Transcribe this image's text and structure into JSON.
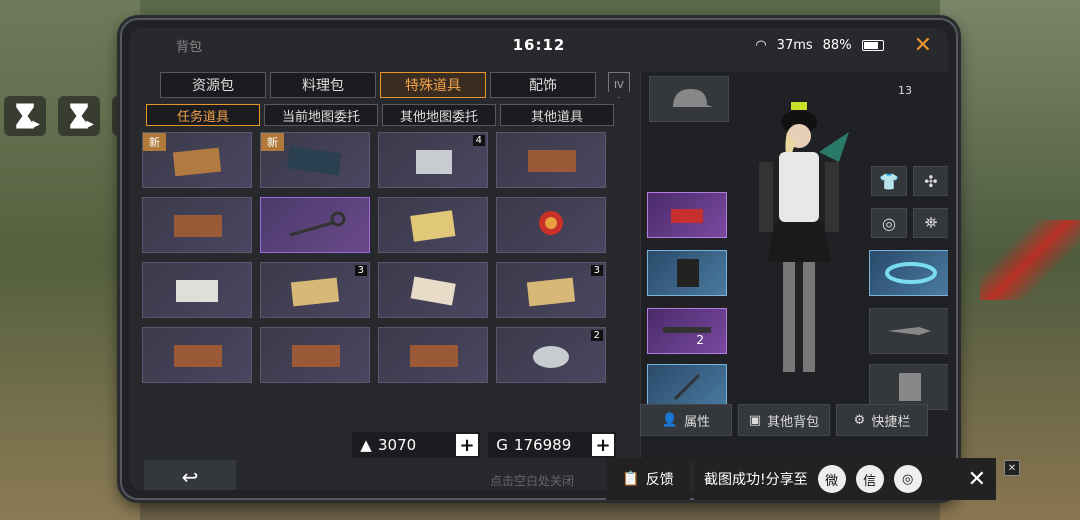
{
  "status": {
    "title": "背包",
    "time": "16:12",
    "ping": "37ms",
    "battery": "88%"
  },
  "tabs": [
    "资源包",
    "料理包",
    "特殊道具",
    "配饰"
  ],
  "tier": "IV",
  "subtabs": [
    "任务道具",
    "当前地图委托",
    "其他地图委托",
    "其他道具"
  ],
  "items": [
    {
      "tag": "新",
      "count": ""
    },
    {
      "tag": "新",
      "count": ""
    },
    {
      "tag": "",
      "count": "4"
    },
    {
      "tag": "",
      "count": ""
    },
    {
      "tag": "",
      "count": ""
    },
    {
      "tag": "",
      "count": ""
    },
    {
      "tag": "",
      "count": ""
    },
    {
      "tag": "",
      "count": ""
    },
    {
      "tag": "",
      "count": ""
    },
    {
      "tag": "",
      "count": "3"
    },
    {
      "tag": "",
      "count": ""
    },
    {
      "tag": "",
      "count": "3"
    },
    {
      "tag": "",
      "count": ""
    },
    {
      "tag": "",
      "count": ""
    },
    {
      "tag": "",
      "count": ""
    },
    {
      "tag": "",
      "count": "2"
    }
  ],
  "currency": {
    "a": "3070",
    "b": "176989"
  },
  "level": "13",
  "weapon_count": "2",
  "buttons": {
    "attr": "属性",
    "other_bag": "其他背包",
    "shortcut": "快捷栏"
  },
  "hint": "点击空白处关闭",
  "share": {
    "feedback": "反馈",
    "text": "截图成功!分享至"
  }
}
